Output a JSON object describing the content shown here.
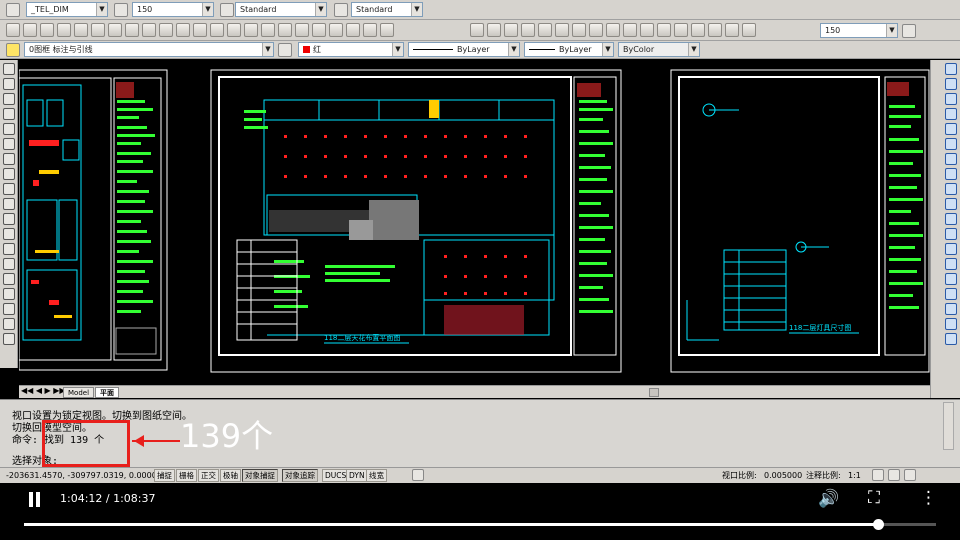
{
  "toolbar1": {
    "dimstyle_value": "_TEL_DIM",
    "dimscale_value": "150",
    "textstyle_value": "Standard",
    "tablestyle_value": "Standard",
    "scale_value": "150"
  },
  "toolbar3": {
    "layer_value": "0图框 标注与引线",
    "color_value": "红",
    "linetype_value": "ByLayer",
    "lineweight_value": "ByLayer",
    "plotstyle_value": "ByColor"
  },
  "layout_tabs": [
    "Model",
    "平面"
  ],
  "drawing_titles": {
    "sheet2": "118二层天花布置平面图",
    "sheet3": "118二层灯具尺寸图"
  },
  "command_lines": [
    "视口设置为锁定视图。切换到图纸空间。",
    "切换回模型空间。",
    "命令: 找到 139 个",
    "选择对象:"
  ],
  "status_bar": {
    "coords": "-203631.4570, -309797.0319, 0.0000",
    "toggles": [
      {
        "label": "捕捉",
        "on": false
      },
      {
        "label": "栅格",
        "on": false
      },
      {
        "label": "正交",
        "on": false
      },
      {
        "label": "极轴",
        "on": false
      },
      {
        "label": "对象捕捉",
        "on": true
      },
      {
        "label": "对象追踪",
        "on": true
      },
      {
        "label": "DUCS",
        "on": false
      },
      {
        "label": "DYN",
        "on": false
      },
      {
        "label": "线宽",
        "on": false
      }
    ],
    "viewport_scale_label": "视口比例:",
    "viewport_scale_value": "0.005000",
    "annotation_scale_label": "注释比例:",
    "annotation_scale_value": "1:1"
  },
  "annotation": {
    "callout_text": "139个"
  },
  "player": {
    "time_display": "1:04:12 / 1:08:37",
    "progress": 0.936
  },
  "colors": {
    "cad_cyan": "#00e5ff",
    "cad_green": "#33ff33",
    "cad_red": "#ff2020",
    "cad_white": "#ffffff",
    "annotation_red": "#e8201c"
  }
}
